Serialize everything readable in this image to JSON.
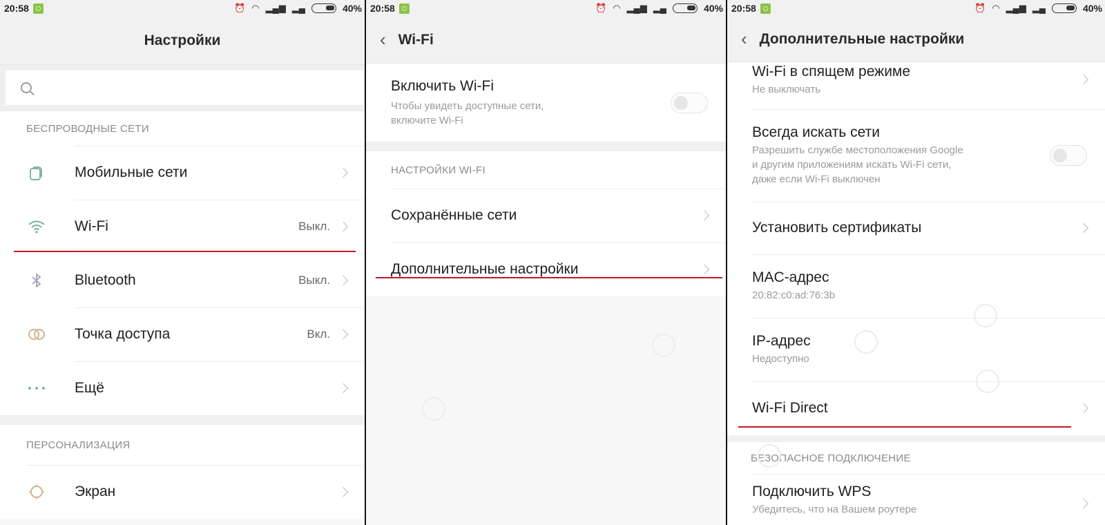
{
  "status_bar": {
    "time": "20:58",
    "battery": "40%",
    "icons": [
      "alarm-icon",
      "wifi-icon",
      "signal-icon",
      "signal-weak-icon",
      "battery-icon"
    ]
  },
  "accent": {
    "highlight_line": "#c2182b"
  },
  "screen1": {
    "title": "Настройки",
    "search_placeholder": "",
    "sections": [
      {
        "title": "БЕСПРОВОДНЫЕ СЕТИ",
        "items": [
          {
            "label": "Мобильные сети",
            "value": "",
            "icon": "sim-cards-icon"
          },
          {
            "label": "Wi-Fi",
            "value": "Выкл.",
            "icon": "wifi-icon"
          },
          {
            "label": "Bluetooth",
            "value": "Выкл.",
            "icon": "bluetooth-icon"
          },
          {
            "label": "Точка доступа",
            "value": "Вкл.",
            "icon": "hotspot-icon"
          },
          {
            "label": "Ещё",
            "value": "",
            "icon": "more-dots-icon"
          }
        ]
      },
      {
        "title": "ПЕРСОНАЛИЗАЦИЯ",
        "items": [
          {
            "label": "Экран",
            "value": "",
            "icon": "brightness-icon"
          }
        ]
      }
    ]
  },
  "screen2": {
    "title": "Wi-Fi",
    "toggle_item": {
      "label": "Включить Wi-Fi",
      "desc_line1": "Чтобы увидеть доступные сети,",
      "desc_line2": "включите Wi-Fi",
      "enabled": false
    },
    "section_title": "НАСТРОЙКИ WI-FI",
    "items": [
      {
        "label": "Сохранённые сети"
      },
      {
        "label": "Дополнительные настройки"
      }
    ]
  },
  "screen3": {
    "title": "Дополнительные настройки",
    "items": [
      {
        "label": "Wi-Fi в спящем режиме",
        "desc": "Не выключать"
      },
      {
        "label": "Всегда искать сети",
        "desc_lines": [
          "Разрешить службе местоположения Google",
          "и другим приложениям искать Wi-Fi сети,",
          "даже если Wi-Fi выключен"
        ],
        "enabled": false
      },
      {
        "label": "Установить сертификаты"
      },
      {
        "label": "MAC-адрес",
        "desc": "20:82:c0:ad:76:3b"
      },
      {
        "label": "IP-адрес",
        "desc": "Недоступно"
      },
      {
        "label": "Wi-Fi Direct"
      }
    ],
    "section_title": "БЕЗОПАСНОЕ ПОДКЛЮЧЕНИЕ",
    "wps": {
      "label": "Подключить WPS",
      "desc": "Убедитесь, что на Вашем роутере"
    }
  }
}
